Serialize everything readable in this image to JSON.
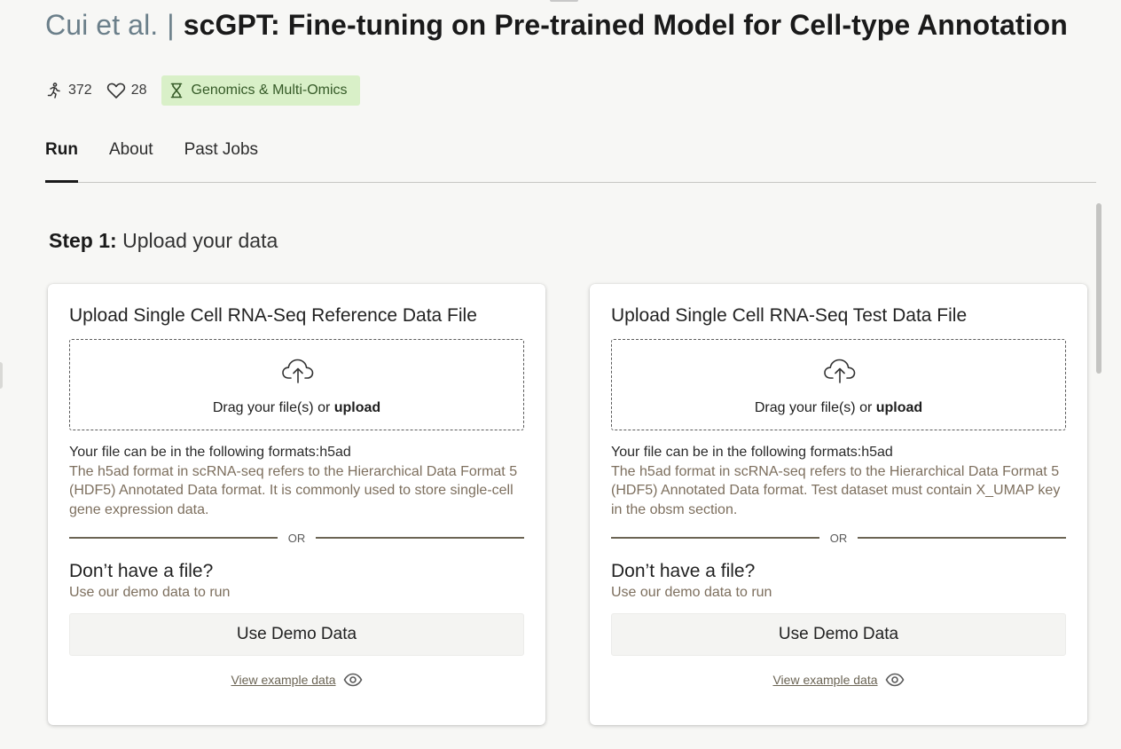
{
  "header": {
    "authors": "Cui et al.",
    "separator": "|",
    "title": "scGPT: Fine-tuning on Pre-trained Model for Cell-type Annotation"
  },
  "meta": {
    "runs_icon": "running-person-icon",
    "runs_count": "372",
    "likes_icon": "heart-icon",
    "likes_count": "28",
    "category_icon": "hourglass-icon",
    "category": "Genomics & Multi-Omics"
  },
  "tabs": [
    {
      "label": "Run",
      "active": true
    },
    {
      "label": "About",
      "active": false
    },
    {
      "label": "Past Jobs",
      "active": false
    }
  ],
  "step": {
    "prefix": "Step 1:",
    "title": "Upload your data"
  },
  "cards": [
    {
      "title": "Upload Single Cell RNA-Seq Reference Data File",
      "upload_icon": "cloud-upload-icon",
      "drop_text": "Drag your file(s) or ",
      "drop_link": "upload",
      "formats_line": "Your file can be in the following formats:h5ad",
      "formats_desc": "The h5ad format in scRNA-seq refers to the Hierarchical Data Format 5 (HDF5) Annotated Data format. It is commonly used to store single-cell gene expression data.",
      "or_label": "OR",
      "no_file_title": "Don’t have a file?",
      "no_file_hint": "Use our demo data to run",
      "demo_button": "Use Demo Data",
      "example_link": "View example data",
      "example_icon": "eye-icon"
    },
    {
      "title": "Upload Single Cell RNA-Seq Test Data File",
      "upload_icon": "cloud-upload-icon",
      "drop_text": "Drag your file(s) or ",
      "drop_link": "upload",
      "formats_line": "Your file can be in the following formats:h5ad",
      "formats_desc": "The h5ad format in scRNA-seq refers to the Hierarchical Data Format 5 (HDF5) Annotated Data format. Test dataset must contain X_UMAP key in the obsm section.",
      "or_label": "OR",
      "no_file_title": "Don’t have a file?",
      "no_file_hint": "Use our demo data to run",
      "demo_button": "Use Demo Data",
      "example_link": "View example data",
      "example_icon": "eye-icon"
    }
  ],
  "colors": {
    "background": "#f7f7f5",
    "tag_bg": "#d9f0c8",
    "tag_text": "#355a27",
    "muted_text": "#7d6f5e",
    "author_text": "#6b7f8a"
  }
}
